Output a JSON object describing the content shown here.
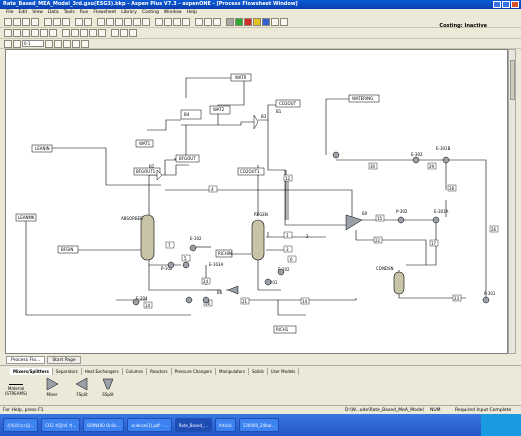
{
  "window": {
    "title": "Rate_Based_MEA_Model_3rd.gsu(ESG3).bkp - Aspen Plus V7.3 - aspenONE - [Process Flowsheet Window]"
  },
  "menu": [
    "File",
    "Edit",
    "View",
    "Data",
    "Tools",
    "Run",
    "Flowsheet",
    "Library",
    "Costing",
    "Window",
    "Help"
  ],
  "costing": {
    "label": "Costing: Inactive"
  },
  "zoom": {
    "value": "0.1"
  },
  "flowsheet": {
    "blocks": {
      "absorber": "ABSORBER",
      "regen": "REGEN",
      "condsn": "CONDSN",
      "b4": "B4",
      "b3": "B3",
      "b2": "B2",
      "bx": "BX",
      "b6": "B6",
      "b1": "B1",
      "e102": "E-102",
      "e103a": "E-103A",
      "e202": "E-202",
      "e302": "E-302",
      "e301b": "E-301B",
      "e301a": "E-301A",
      "e204": "E-204",
      "p302": "P-302",
      "p301": "P-301",
      "p102": "P-102",
      "p201": "P-201"
    },
    "streams": {
      "leanin": "LEANIN",
      "leanmk": "LEANMK",
      "bfgin": "BFGIN",
      "bfgout1": "BFGOUT1",
      "bfgout": "BFGOUT",
      "wat1": "WAT1",
      "wat2": "WAT2",
      "watr": "WATR",
      "co2out": "CO2OUT",
      "co2out1": "CO2OUT1",
      "watering": "WATERING",
      "rich1": "RICH1",
      "richin": "RICHIN",
      "s1": "1",
      "s2": "2",
      "s3": "3",
      "s4": "4",
      "s5": "5",
      "s6": "6",
      "s7": "7",
      "s12": "12",
      "s13": "13",
      "s14": "14",
      "s15": "15",
      "s16": "16",
      "s17": "17",
      "s21": "21",
      "s22": "22",
      "s23": "23",
      "s24": "24",
      "s25": "25",
      "s26": "26",
      "s27": "27",
      "s28": "28",
      "s29": "29",
      "s30": "30"
    }
  },
  "tabs": [
    "Process Flo...",
    "Start Page"
  ],
  "palette": {
    "tabs": [
      "Mixers/Splitters",
      "Separators",
      "Heat Exchangers",
      "Columns",
      "Reactors",
      "Pressure Changers",
      "Manipulators",
      "Solids",
      "User Models"
    ],
    "items": [
      "Material\n(STREAMS)",
      "Mixer",
      "FSplit",
      "SSplit"
    ]
  },
  "status": {
    "help": "For Help, press F1",
    "path": "D:\\W...ode\\Rate_Based_MeA_Model",
    "num": "NUM",
    "state": "Required Input Complete"
  },
  "taskbar": {
    "items": [
      "신의료/고시당...",
      "CO2 저장/과 기...",
      "BOIN400 Onlin...",
      "science(1).pdf - ...",
      "Rate_Based_...",
      "Article",
      "120000_24bar..."
    ]
  },
  "colors": {
    "accent": "#0a3fb0",
    "line": "#000000"
  }
}
